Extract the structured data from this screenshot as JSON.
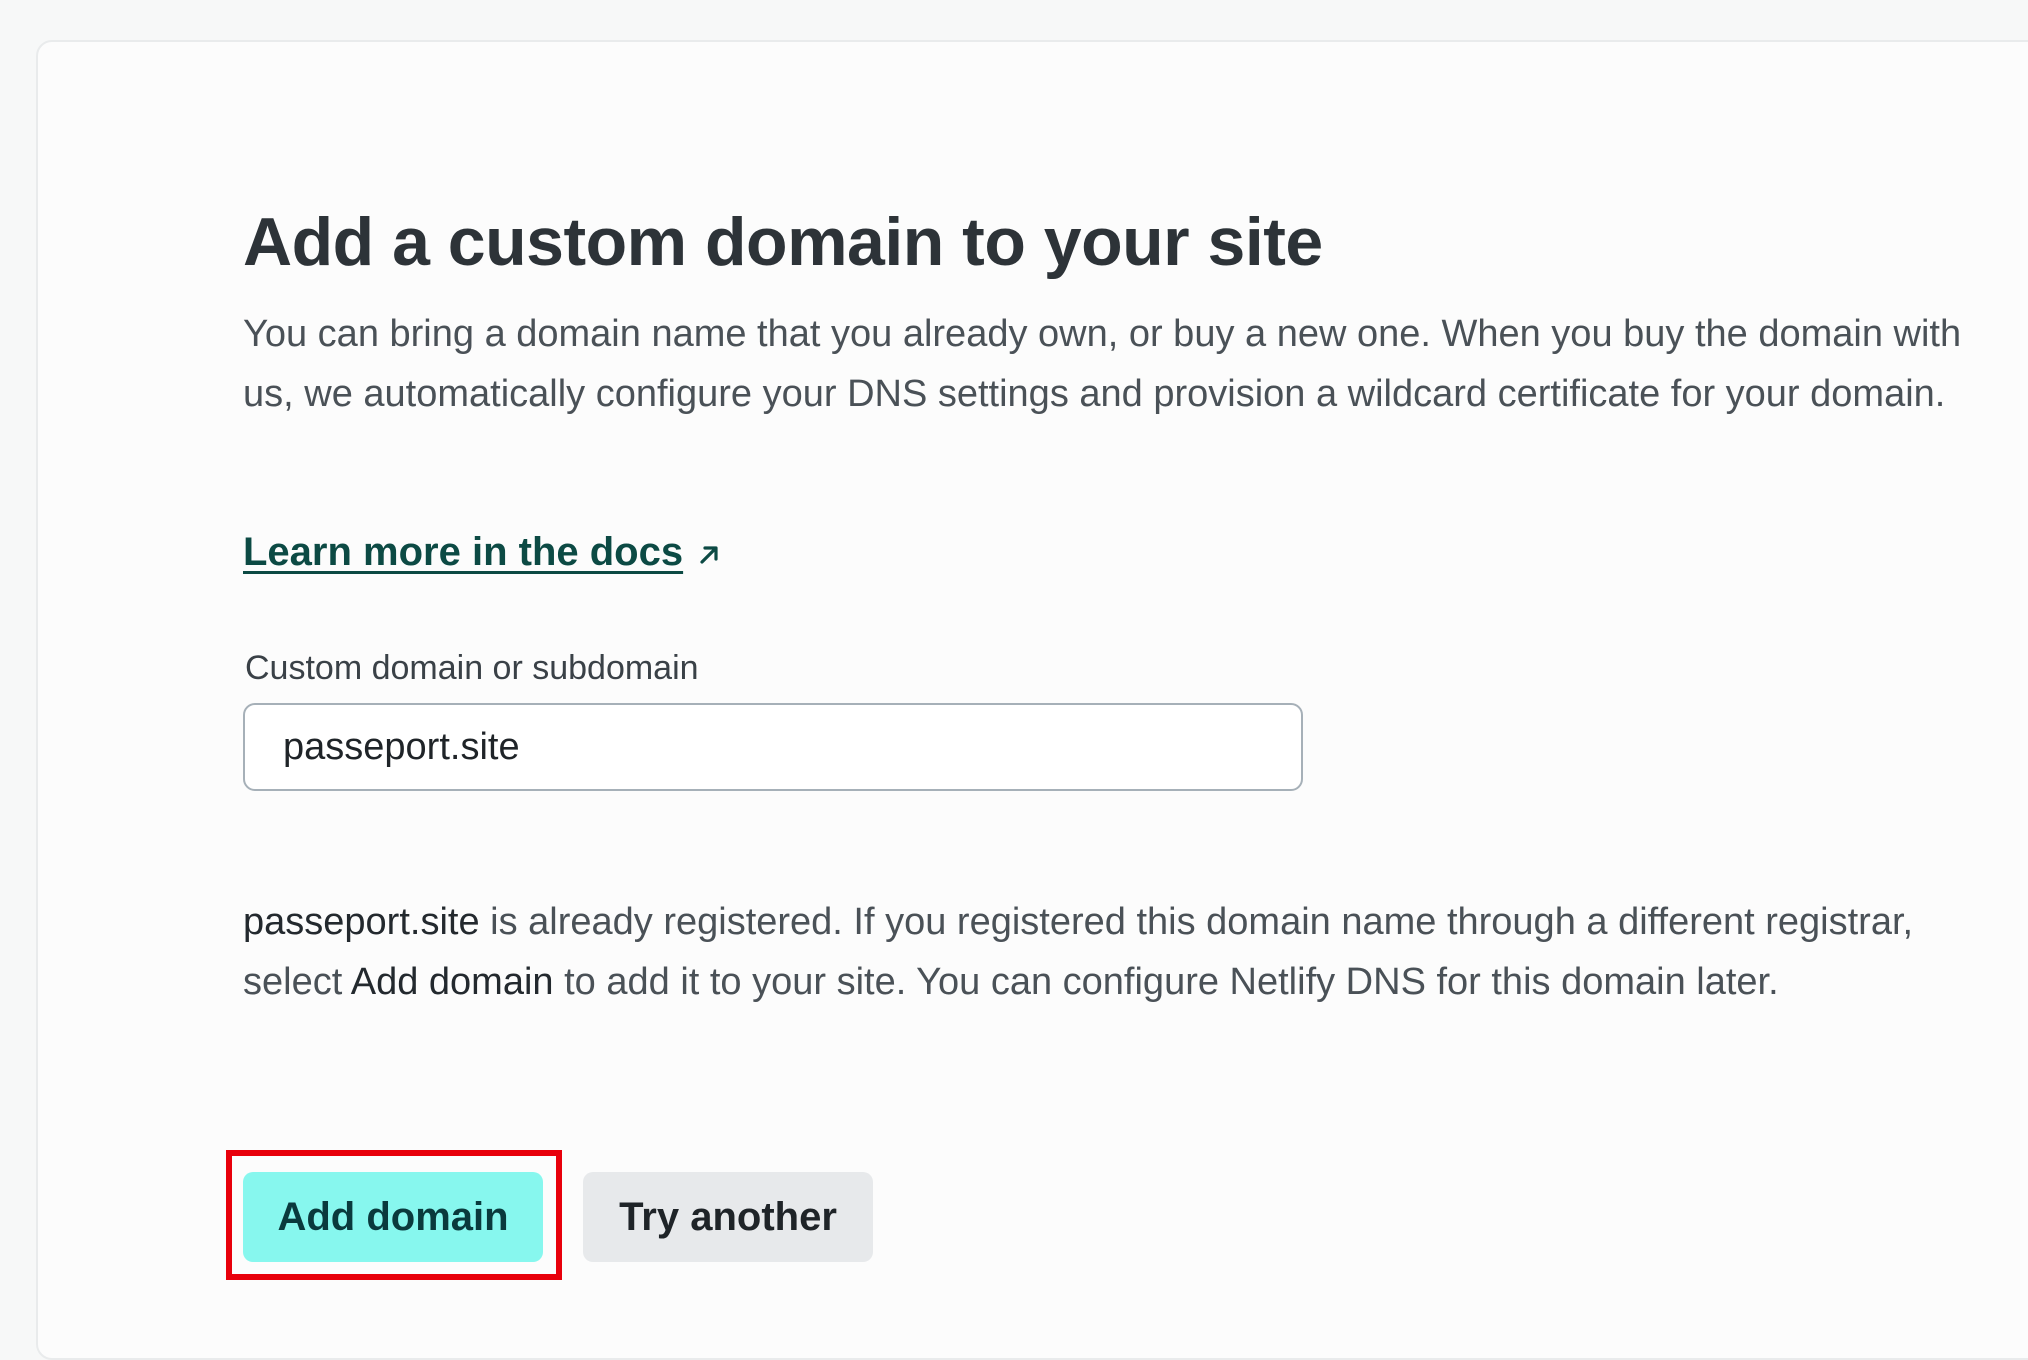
{
  "page": {
    "title": "Add a custom domain to your site",
    "description": "You can bring a domain name that you already own, or buy a new one. When you buy the domain with us, we automatically configure your DNS settings and provision a wildcard certificate for your domain.",
    "docs_link": "Learn more in the docs",
    "docs_link_icon": "external-arrow-icon"
  },
  "form": {
    "label": "Custom domain or subdomain",
    "value": "passeport.site"
  },
  "message": {
    "domain": "passeport.site",
    "part1": " is already registered. If you registered this domain name through a different registrar, select ",
    "action": "Add domain",
    "part2": " to add it to your site. You can configure Netlify DNS for this domain later."
  },
  "actions": {
    "add_label": "Add domain",
    "try_another_label": "Try another"
  },
  "colors": {
    "primary_button": "#87f7ee",
    "secondary_button": "#e7e9eb",
    "link": "#0c4a44",
    "highlight": "#e8000b"
  }
}
